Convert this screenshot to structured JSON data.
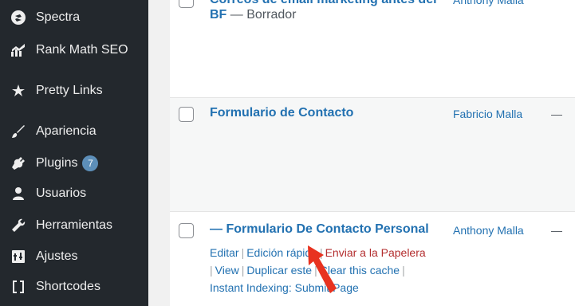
{
  "sidebar": {
    "items": [
      {
        "label": "Spectra",
        "icon": "spectra-icon"
      },
      {
        "label": "Rank Math SEO",
        "icon": "rank-math-icon"
      },
      {
        "label": "Pretty Links",
        "icon": "pretty-links-icon"
      },
      {
        "label": "Apariencia",
        "icon": "paintbrush-icon"
      },
      {
        "label": "Plugins",
        "icon": "plugin-icon",
        "badge": "7"
      },
      {
        "label": "Usuarios",
        "icon": "user-icon"
      },
      {
        "label": "Herramientas",
        "icon": "wrench-icon"
      },
      {
        "label": "Ajustes",
        "icon": "settings-icon"
      },
      {
        "label": "Shortcodes",
        "icon": "shortcode-icon"
      }
    ]
  },
  "rows": [
    {
      "title_line1": "Correos de email marketing antes del",
      "title_line2": "BF",
      "state": " — Borrador",
      "author": "Anthony Malla"
    },
    {
      "title": "Formulario de Contacto",
      "author": "Fabricio Malla",
      "dash": "—"
    },
    {
      "title": "— Formulario De Contacto Personal",
      "author": "Anthony Malla",
      "dash": "—",
      "actions": {
        "edit": "Editar",
        "quick_edit": "Edición rápida",
        "trash": "Enviar a la Papelera",
        "view": "View",
        "duplicate": "Duplicar este",
        "clear_cache": "Clear this cache",
        "instant_indexing": "Instant Indexing: Submit Page"
      }
    }
  ],
  "colors": {
    "sidebar_bg": "#23282d",
    "link": "#2271b1",
    "trash": "#b32d2e",
    "arrow": "#e8321f"
  }
}
